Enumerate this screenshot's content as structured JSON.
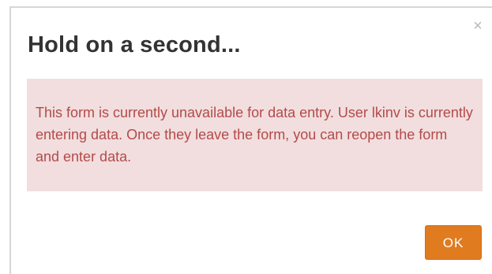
{
  "dialog": {
    "title": "Hold on a second...",
    "close_icon": "close-icon",
    "close_glyph": "×",
    "message": "This form is currently unavailable for data entry. User lkinv is currently entering data. Once they leave the form, you can reopen the form and enter data.",
    "ok_label": "OK"
  },
  "colors": {
    "alert_background": "#f2dede",
    "alert_text": "#b44a4a",
    "button_background": "#e07b20",
    "title_text": "#333333"
  }
}
